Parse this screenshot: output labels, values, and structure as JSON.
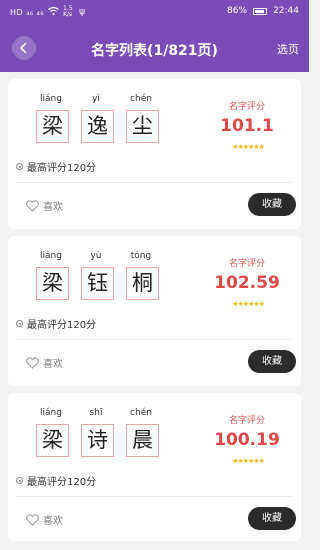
{
  "status": {
    "signal": "HD ₄₆ ₄₆",
    "speed": "1.5 K/s",
    "battery": "86%",
    "battery_level": 0.86,
    "time": "22:44"
  },
  "header": {
    "title": "名字列表(1/821页)",
    "select_label": "选页"
  },
  "labels": {
    "score_label": "名字评分",
    "max_score": "最高评分120分",
    "like": "喜欢",
    "collect": "收藏",
    "stars": "★★★★★★"
  },
  "names": [
    {
      "chars": [
        "梁",
        "逸",
        "尘"
      ],
      "pinyin": [
        "liáng",
        "yì",
        "chén"
      ],
      "score": "101.1"
    },
    {
      "chars": [
        "梁",
        "钰",
        "桐"
      ],
      "pinyin": [
        "liáng",
        "yù",
        "tóng"
      ],
      "score": "102.59"
    },
    {
      "chars": [
        "梁",
        "诗",
        "晨"
      ],
      "pinyin": [
        "liáng",
        "shī",
        "chén"
      ],
      "score": "100.19"
    }
  ],
  "colors": {
    "header": "#7b4bb8",
    "score": "#e04848",
    "star": "#f2b70b",
    "button": "#2b2b2b"
  }
}
